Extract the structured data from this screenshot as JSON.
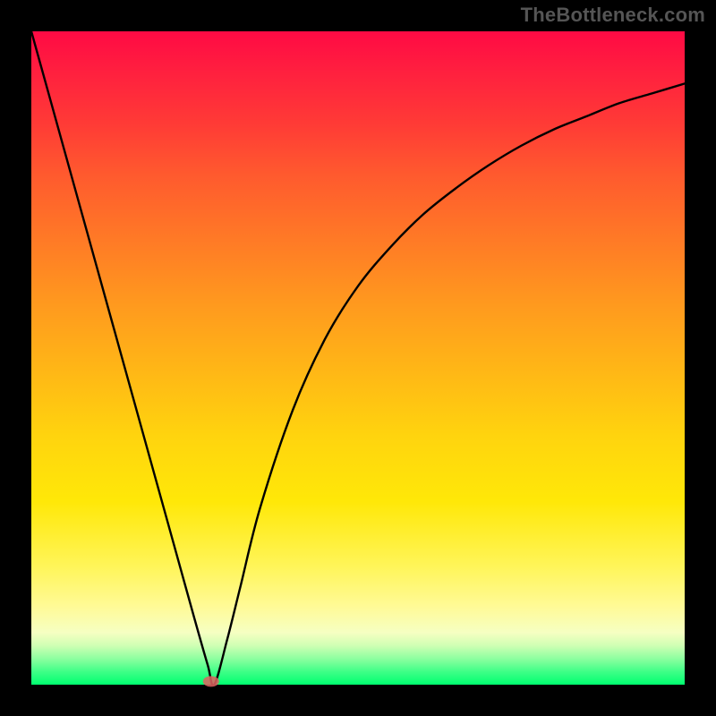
{
  "attribution": "TheBottleneck.com",
  "chart_data": {
    "type": "line",
    "title": "",
    "xlabel": "",
    "ylabel": "",
    "xlim": [
      0,
      100
    ],
    "ylim": [
      0,
      100
    ],
    "series": [
      {
        "name": "curve",
        "x": [
          0,
          5,
          10,
          15,
          20,
          22.5,
          25,
          27,
          28,
          30,
          32,
          35,
          40,
          45,
          50,
          55,
          60,
          65,
          70,
          75,
          80,
          85,
          90,
          95,
          100
        ],
        "values": [
          100,
          82,
          64,
          46,
          28,
          19,
          10,
          3,
          0,
          7,
          15,
          27,
          42,
          53,
          61,
          67,
          72,
          76,
          79.5,
          82.5,
          85,
          87,
          89,
          90.5,
          92
        ]
      }
    ],
    "points": [
      {
        "name": "current-config-marker",
        "x": 27.5,
        "y": 0.5
      }
    ],
    "background": {
      "gradient_stops": [
        {
          "pos": 0,
          "color": "#ff0a44"
        },
        {
          "pos": 40,
          "color": "#ff9a1e"
        },
        {
          "pos": 72,
          "color": "#ffe808"
        },
        {
          "pos": 100,
          "color": "#00ff70"
        }
      ]
    }
  }
}
